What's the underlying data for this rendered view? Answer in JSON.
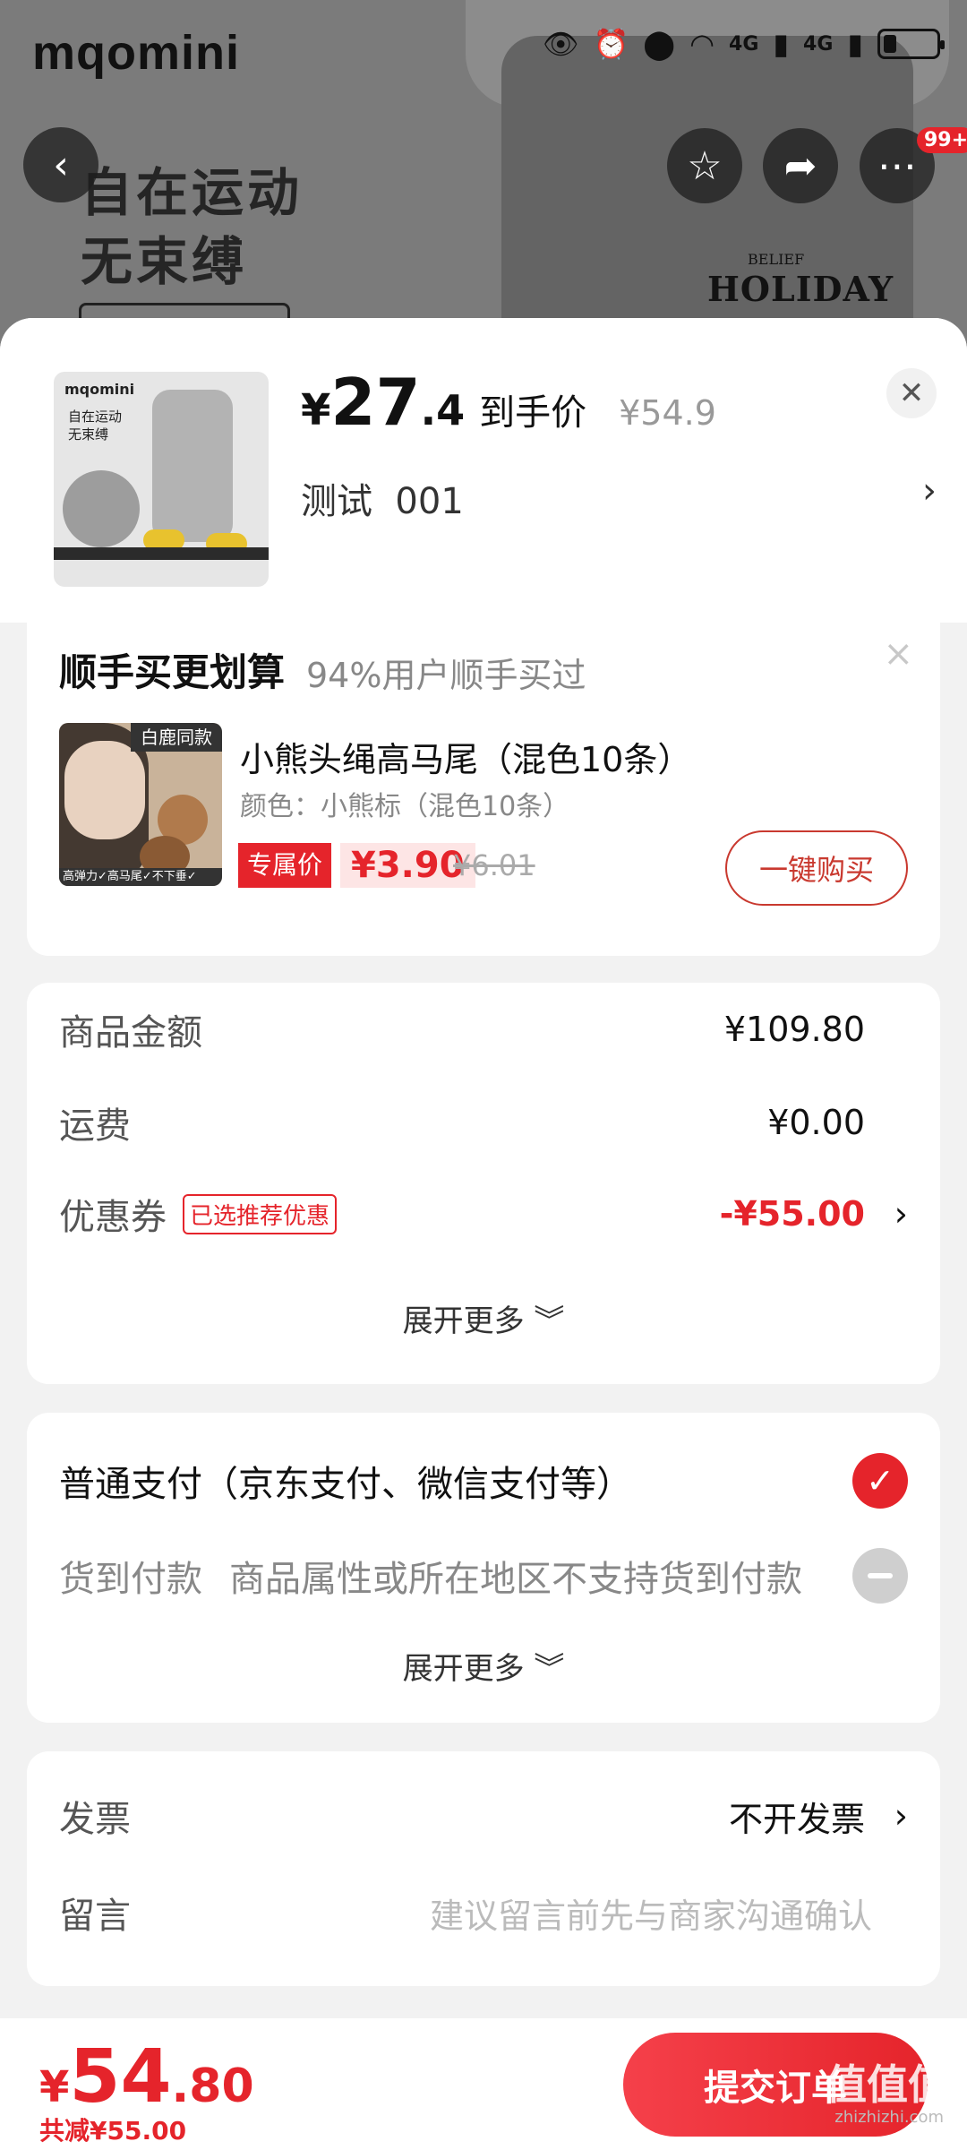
{
  "background": {
    "brand": "mqomini",
    "slogan_line1": "自在运动",
    "slogan_line2": "无束缚",
    "print_text": "HOLIDAY",
    "print_sub": "BELIEF",
    "badge_count": "99+"
  },
  "status_bar": {
    "icons": [
      "eye-icon",
      "alarm-icon",
      "location-icon",
      "wifi-icon",
      "signal-4g-icon",
      "signal-4g-icon",
      "battery-icon"
    ],
    "net_labels": [
      "4G",
      "4G"
    ]
  },
  "header": {
    "price_symbol": "¥",
    "price_int": "27",
    "price_dec": ".4",
    "price_label": "到手价",
    "original_price": "¥54.9",
    "spec": "测试  001",
    "thumb_brand": "mqomini",
    "thumb_text": "自在运动\n无束缚",
    "close_label": "✕"
  },
  "addon": {
    "title": "顺手买更划算",
    "subtitle": "94%用户顺手买过",
    "thumb_tag": "白鹿同款",
    "thumb_strip": "高弹力✓高马尾✓不下垂✓",
    "name": "小熊头绳高马尾（混色10条）",
    "spec": "颜色：小熊标（混色10条）",
    "exclusive_label": "专属价",
    "price": "¥3.90",
    "original_price": "¥6.01",
    "buy_button": "一键购买"
  },
  "amounts": {
    "goods_label": "商品金额",
    "goods_value": "¥109.80",
    "shipping_label": "运费",
    "shipping_value": "¥0.00",
    "coupon_label": "优惠券",
    "coupon_chip": "已选推荐优惠",
    "coupon_value": "-¥55.00",
    "expand_label": "展开更多"
  },
  "payment": {
    "normal_label": "普通支付（京东支付、微信支付等）",
    "cod_label": "货到付款",
    "cod_desc": "商品属性或所在地区不支持货到付款",
    "expand_label": "展开更多"
  },
  "misc": {
    "invoice_label": "发票",
    "invoice_value": "不开发票",
    "note_label": "留言",
    "note_placeholder": "建议留言前先与商家沟通确认"
  },
  "footer": {
    "total_symbol": "¥",
    "total_int": "54",
    "total_dec": ".80",
    "saved": "共减¥55.00",
    "submit": "提交订单",
    "watermark": "值值值",
    "watermark_sub": "zhizhizhi.com"
  },
  "colors": {
    "accent": "#e5242b",
    "background": "#f2f2f2"
  }
}
